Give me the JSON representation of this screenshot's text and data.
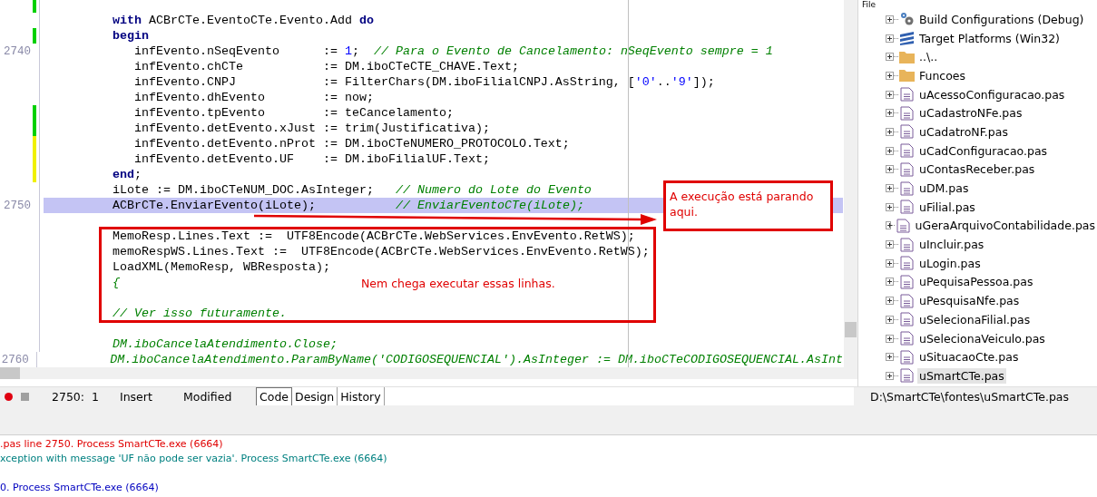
{
  "editor": {
    "lines": [
      {
        "color": "#00d000",
        "highlighted": false
      },
      {
        "highlighted": false,
        "tokens": [
          {
            "kind": "keyword",
            "text": "          with"
          },
          {
            "kind": "plain",
            "text": " ACBrCTe.EventoCTe.Evento.Add "
          },
          {
            "kind": "keyword",
            "text": "do"
          }
        ]
      },
      {
        "color": "#00d000",
        "highlighted": false,
        "tokens": [
          {
            "kind": "keyword",
            "text": "          begin"
          }
        ]
      },
      {
        "number": "2740",
        "highlighted": false,
        "tokens": [
          {
            "kind": "plain",
            "text": "             infEvento.nSeqEvento      := "
          },
          {
            "kind": "number",
            "text": "1"
          },
          {
            "kind": "plain",
            "text": ";  "
          },
          {
            "kind": "comment",
            "text": "// Para o Evento de Cancelamento: nSeqEvento sempre = 1"
          }
        ]
      },
      {
        "highlighted": false,
        "tokens": [
          {
            "kind": "plain",
            "text": "             infEvento.chCTe           := DM.iboCTeCTE_CHAVE.Text;"
          }
        ]
      },
      {
        "highlighted": false,
        "tokens": [
          {
            "kind": "plain",
            "text": "             infEvento.CNPJ            := FilterChars(DM.iboFilialCNPJ.AsString, ["
          },
          {
            "kind": "string",
            "text": "'0'"
          },
          {
            "kind": "plain",
            "text": ".."
          },
          {
            "kind": "string",
            "text": "'9'"
          },
          {
            "kind": "plain",
            "text": "]);"
          }
        ]
      },
      {
        "highlighted": false,
        "tokens": [
          {
            "kind": "plain",
            "text": "             infEvento.dhEvento        := now;"
          }
        ]
      },
      {
        "color": "#00d000",
        "highlighted": false,
        "tokens": [
          {
            "kind": "plain",
            "text": "             infEvento.tpEvento        := teCancelamento;"
          }
        ]
      },
      {
        "color": "#00d000",
        "highlighted": false,
        "tokens": [
          {
            "kind": "plain",
            "text": "             infEvento.detEvento.xJust := trim(Justificativa);"
          }
        ]
      },
      {
        "color": "#f0f000",
        "highlighted": false,
        "tokens": [
          {
            "kind": "plain",
            "text": "             infEvento.detEvento.nProt := DM.iboCTeNUMERO_PROTOCOLO.Text;"
          }
        ]
      },
      {
        "color": "#f0f000",
        "highlighted": false,
        "tokens": [
          {
            "kind": "plain",
            "text": "             infEvento.detEvento.UF    := DM.iboFilialUF.Text;"
          }
        ]
      },
      {
        "color": "#f0f000",
        "highlighted": false,
        "tokens": [
          {
            "kind": "keyword",
            "text": "          end"
          },
          {
            "kind": "plain",
            "text": ";"
          }
        ]
      },
      {
        "highlighted": false,
        "tokens": [
          {
            "kind": "plain",
            "text": "          iLote := DM.iboCTeNUM_DOC.AsInteger;   "
          },
          {
            "kind": "comment",
            "text": "// Numero do Lote do Evento"
          }
        ]
      },
      {
        "number": "2750",
        "highlighted": true,
        "tokens": [
          {
            "kind": "plain",
            "text": "          ACBrCTe.EnviarEvento(iLote);           "
          },
          {
            "kind": "comment",
            "text": "// EnviarEventoCTe(iLote);"
          }
        ]
      },
      {
        "highlighted": false
      },
      {
        "highlighted": false,
        "tokens": [
          {
            "kind": "plain",
            "text": "          MemoResp.Lines.Text :=  UTF8Encode(ACBrCTe.WebServices.EnvEvento.RetWS);"
          }
        ]
      },
      {
        "highlighted": false,
        "tokens": [
          {
            "kind": "plain",
            "text": "          memoRespWS.Lines.Text :=  UTF8Encode(ACBrCTe.WebServices.EnvEvento.RetWS);"
          }
        ]
      },
      {
        "highlighted": false,
        "tokens": [
          {
            "kind": "plain",
            "text": "          LoadXML(MemoResp, WBResposta);"
          }
        ]
      },
      {
        "highlighted": false,
        "tokens": [
          {
            "kind": "comment",
            "text": "          {"
          }
        ]
      },
      {
        "highlighted": false
      },
      {
        "highlighted": false,
        "tokens": [
          {
            "kind": "comment",
            "text": "          // Ver isso futuramente."
          }
        ]
      },
      {
        "highlighted": false
      },
      {
        "highlighted": false,
        "tokens": [
          {
            "kind": "comment",
            "text": "          DM.iboCancelaAtendimento.Close;"
          }
        ]
      },
      {
        "number": "2760",
        "highlighted": false,
        "tokens": [
          {
            "kind": "comment",
            "text": "          DM.iboCancelaAtendimento.ParamByName('CODIGOSEQUENCIAL').AsInteger := DM.iboCTeCODIGOSEQUENCIAL.AsInt"
          }
        ]
      }
    ]
  },
  "annotations": [
    {
      "kind": "callout",
      "text": "A execução está parando aqui."
    },
    {
      "kind": "region",
      "text": "Nem chega executar essas linhas."
    }
  ],
  "project_tree": {
    "header": "File",
    "items": [
      {
        "kind": "gear",
        "label": "Build Configurations (Debug)",
        "selected": false
      },
      {
        "kind": "layers",
        "label": "Target Platforms (Win32)",
        "selected": false
      },
      {
        "kind": "folder",
        "label": "..\\..",
        "selected": false
      },
      {
        "kind": "folder",
        "label": "Funcoes",
        "selected": false
      },
      {
        "kind": "file",
        "label": "uAcessoConfiguracao.pas",
        "selected": false
      },
      {
        "kind": "file",
        "label": "uCadastroNFe.pas",
        "selected": false
      },
      {
        "kind": "file",
        "label": "uCadatroNF.pas",
        "selected": false
      },
      {
        "kind": "file",
        "label": "uCadConfiguracao.pas",
        "selected": false
      },
      {
        "kind": "file",
        "label": "uContasReceber.pas",
        "selected": false
      },
      {
        "kind": "file",
        "label": "uDM.pas",
        "selected": false
      },
      {
        "kind": "file",
        "label": "uFilial.pas",
        "selected": false
      },
      {
        "kind": "file",
        "label": "uGeraArquivoContabilidade.pas",
        "selected": false
      },
      {
        "kind": "file",
        "label": "uIncluir.pas",
        "selected": false
      },
      {
        "kind": "file",
        "label": "uLogin.pas",
        "selected": false
      },
      {
        "kind": "file",
        "label": "uPequisaPessoa.pas",
        "selected": false
      },
      {
        "kind": "file",
        "label": "uPesquisaNfe.pas",
        "selected": false
      },
      {
        "kind": "file",
        "label": "uSelecionaFilial.pas",
        "selected": false
      },
      {
        "kind": "file",
        "label": "uSelecionaVeiculo.pas",
        "selected": false
      },
      {
        "kind": "file",
        "label": "uSituacaoCte.pas",
        "selected": false
      },
      {
        "kind": "file",
        "label": "uSmartCTe.pas",
        "selected": true
      }
    ]
  },
  "status_bar": {
    "position": "2750:  1",
    "mode": "Insert",
    "state": "Modified",
    "tabs": [
      {
        "label": "Code",
        "selected": true
      },
      {
        "label": "Design",
        "selected": false
      },
      {
        "label": "History",
        "selected": false
      }
    ],
    "path": "D:\\SmartCTe\\fontes\\uSmartCTe.pas"
  },
  "messages": [
    {
      "kind": "error",
      "text": ".pas line 2750. Process SmartCTe.exe (6664)"
    },
    {
      "kind": "exception",
      "text": "xception with message 'UF não pode ser vazia'. Process SmartCTe.exe (6664)"
    },
    {
      "kind": "info",
      "text": "0. Process SmartCTe.exe (6664)"
    }
  ]
}
